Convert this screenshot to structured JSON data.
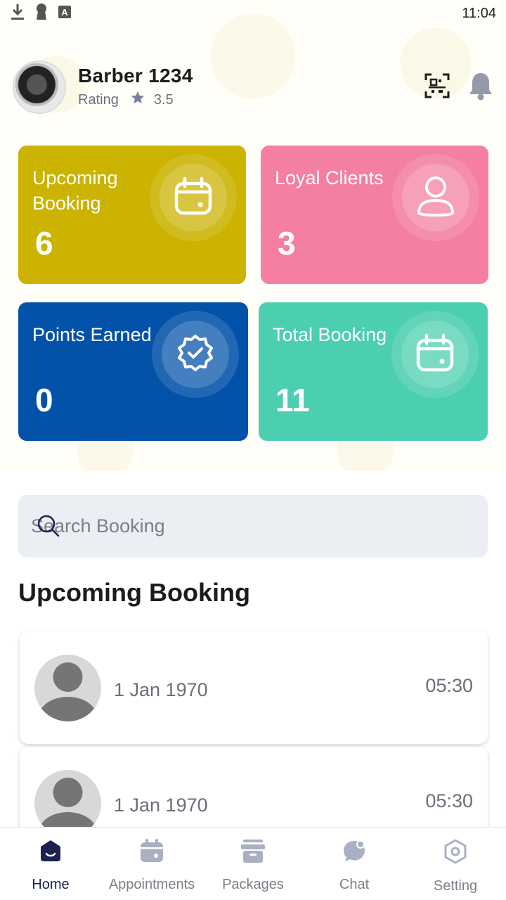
{
  "status_bar": {
    "time": "11:04",
    "icons": [
      "download-icon",
      "keyhole-icon",
      "a-box-icon"
    ]
  },
  "header": {
    "name": "Barber 1234",
    "rating_label": "Rating",
    "rating_value": "3.5",
    "actions": [
      "qr-scan-icon",
      "bell-icon"
    ]
  },
  "cards": [
    {
      "label": "Upcoming Booking",
      "value": "6",
      "color": "#cbb300",
      "icon": "calendar-icon"
    },
    {
      "label": "Loyal Clients",
      "value": "3",
      "color": "#f47fa1",
      "icon": "user-icon"
    },
    {
      "label": "Points Earned",
      "value": "0",
      "color": "#0352a9",
      "icon": "verified-badge-icon"
    },
    {
      "label": "Total Booking",
      "value": "11",
      "color": "#4ccfb1",
      "icon": "calendar-icon"
    }
  ],
  "search": {
    "placeholder": "Search Booking"
  },
  "section": {
    "title": "Upcoming Booking"
  },
  "bookings": [
    {
      "date": "1 Jan 1970",
      "time": "05:30"
    },
    {
      "date": "1 Jan 1970",
      "time": "05:30"
    }
  ],
  "nav": {
    "items": [
      {
        "label": "Home",
        "icon": "home-icon",
        "active": true
      },
      {
        "label": "Appointments",
        "icon": "calendar-icon",
        "active": false
      },
      {
        "label": "Packages",
        "icon": "package-icon",
        "active": false
      },
      {
        "label": "Chat",
        "icon": "chat-icon",
        "active": false
      },
      {
        "label": "Setting",
        "icon": "settings-icon",
        "active": false
      }
    ]
  },
  "colors": {
    "nav_active": "#1b2250",
    "nav_inactive": "#a9b0c2"
  }
}
